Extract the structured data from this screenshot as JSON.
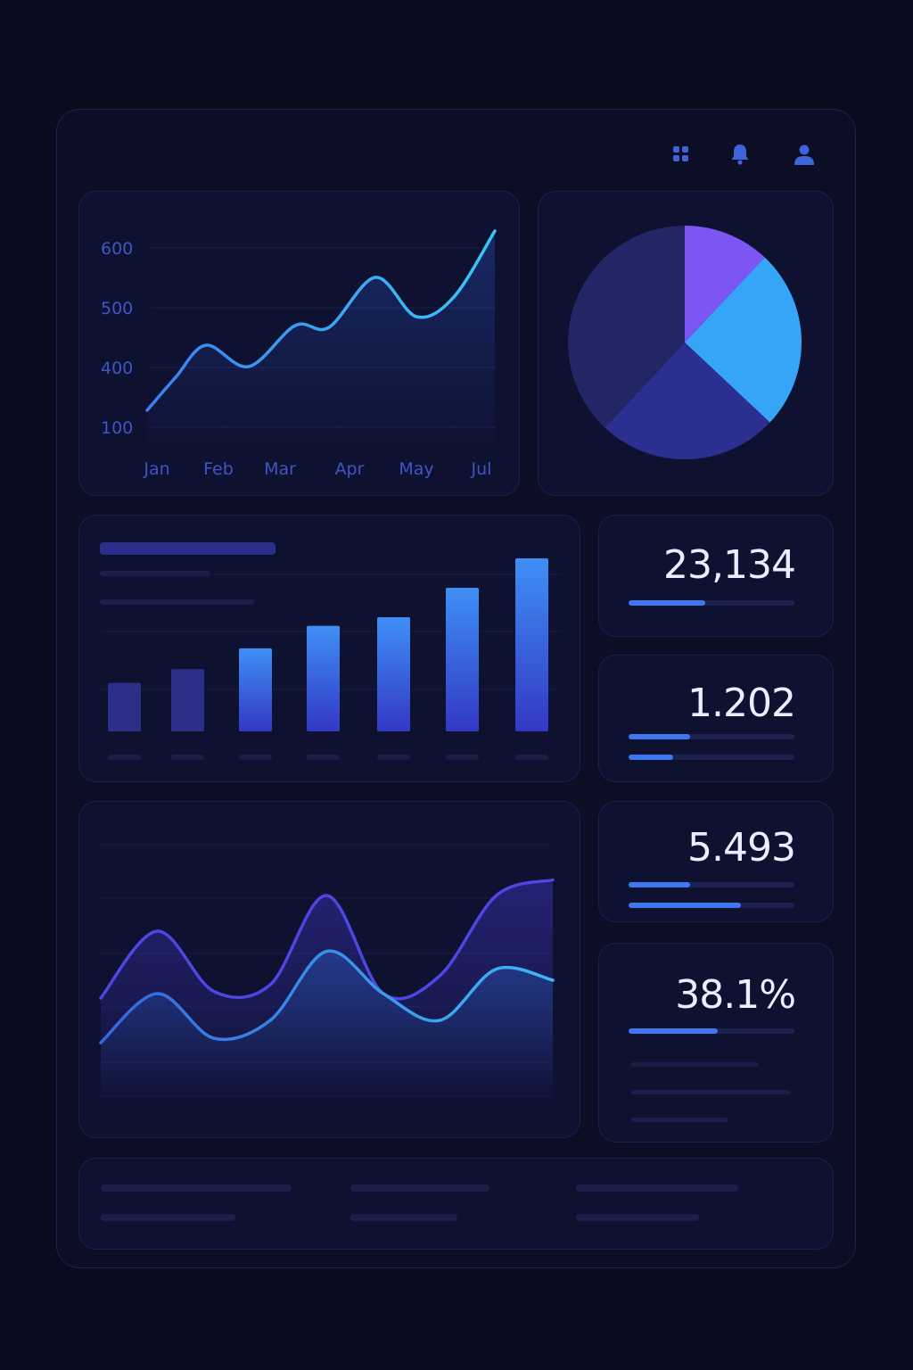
{
  "header": {
    "icons": [
      "apps-grid-icon",
      "bell-icon",
      "user-icon"
    ]
  },
  "colors": {
    "background": "#0a0b1f",
    "panel": "#0e1130",
    "accent": "#3d78f0",
    "line_cyan": "#38b6f5",
    "line_violet": "#4d46e0"
  },
  "line_chart": {
    "chart_data": {
      "type": "line",
      "x": [
        "Jan",
        "Feb",
        "Mar",
        "Apr",
        "May",
        "Jul"
      ],
      "y_ticks": [
        "600",
        "500",
        "400",
        "100"
      ],
      "series": [
        {
          "values": [
            115,
            280,
            290,
            340,
            405,
            590
          ]
        }
      ]
    }
  },
  "pie_chart": {
    "chart_data": {
      "type": "pie",
      "slices": [
        {
          "value": 12,
          "color": "#7d55f2"
        },
        {
          "value": 25,
          "color": "#36a4f7"
        },
        {
          "value": 25,
          "color": "#2b2f8f"
        },
        {
          "value": 38,
          "color": "#222665"
        }
      ]
    }
  },
  "bar_chart": {
    "chart_data": {
      "type": "bar",
      "values": [
        28,
        36,
        48,
        61,
        66,
        83,
        100
      ]
    }
  },
  "kpis": [
    {
      "value": "23,134",
      "progress": [
        0.46
      ]
    },
    {
      "value": "1.202",
      "progress": [
        0.37,
        0.27
      ]
    },
    {
      "value": "5.493",
      "progress": [
        0.37,
        0.68
      ]
    },
    {
      "value": "38.1%",
      "progress": [
        0.54
      ]
    }
  ],
  "area_chart": {
    "chart_data": {
      "type": "area",
      "series": [
        {
          "color": "#4d46e0",
          "values": [
            0.32,
            0.62,
            0.35,
            0.38,
            0.78,
            0.34,
            0.42,
            0.78,
            0.85
          ]
        },
        {
          "color": "#38b6f5",
          "values": [
            0.12,
            0.34,
            0.14,
            0.22,
            0.53,
            0.34,
            0.22,
            0.45,
            0.4
          ]
        }
      ]
    }
  }
}
